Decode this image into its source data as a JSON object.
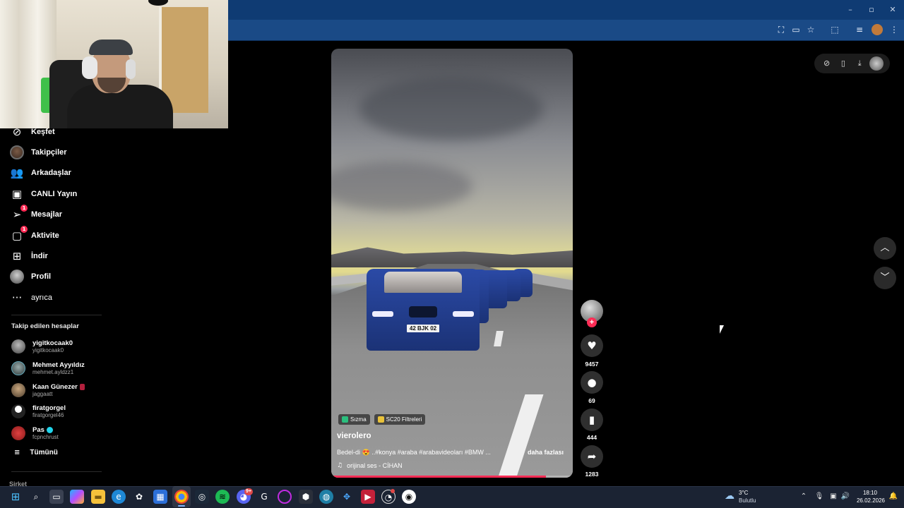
{
  "sidebar": {
    "items": [
      {
        "label": "Keşfet",
        "icon": "compass-icon"
      },
      {
        "label": "Takipçiler",
        "icon": "avatar"
      },
      {
        "label": "Arkadaşlar",
        "icon": "friends-icon"
      },
      {
        "label": "CANLI Yayın",
        "icon": "live-icon"
      },
      {
        "label": "Mesajlar",
        "icon": "messages-icon",
        "badge": "1"
      },
      {
        "label": "Aktivite",
        "icon": "activity-icon",
        "badge": "1"
      },
      {
        "label": "İndir",
        "icon": "download-icon"
      },
      {
        "label": "Profil",
        "icon": "avatar"
      },
      {
        "label": "ayrıca",
        "icon": "more-icon"
      }
    ],
    "following_title": "Takip edilen hesaplar",
    "accounts": [
      {
        "name": "yigitkocaak0",
        "handle": "yigitkocaak0"
      },
      {
        "name": "Mehmet Ayyıldız",
        "handle": "mehmet.ayldzz1"
      },
      {
        "name": "Kaan Günezer",
        "handle": "jaggaatt",
        "live": true
      },
      {
        "name": "firatgorgel",
        "handle": "firatgorgel46"
      },
      {
        "name": "Pas",
        "handle": "fcpnchrust",
        "verified": true
      }
    ],
    "see_all": "Tümünü",
    "company": "Şirket"
  },
  "video": {
    "plate": "42 BJK 02",
    "tags": [
      {
        "label": "Sızma",
        "color": "#2bbf7e"
      },
      {
        "label": "SC20 Filtreleri",
        "color": "#e9c23a"
      }
    ],
    "username": "vierolero",
    "description": "Bedel-di 😍 ..#konya #araba #arabavideoları #BMW ...",
    "more": "daha fazlası",
    "music": "orijinal ses - CİHAN",
    "progress": 0.89
  },
  "actions": {
    "likes": "9457",
    "comments": "69",
    "saves": "444",
    "shares": "1283"
  },
  "taskbar": {
    "weather_temp": "3°C",
    "weather_cond": "Bulutlu",
    "time": "18:10",
    "date": "26.02.2026",
    "discord_badge": "9+"
  },
  "colors": {
    "accent": "#fe2c55",
    "titlebar": "#0f3b73",
    "addrbar": "#1a4a86",
    "taskbar": "#1b2333"
  }
}
